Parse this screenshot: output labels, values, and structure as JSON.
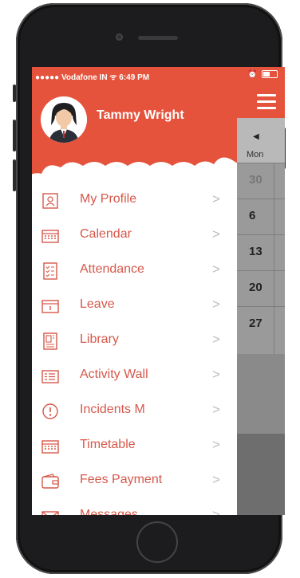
{
  "status_bar": {
    "carrier": "●●●●● Vodafone IN",
    "time": "6:49 PM"
  },
  "drawer": {
    "user_name": "Tammy Wright",
    "items": [
      {
        "label": "My Profile",
        "icon": "profile-icon"
      },
      {
        "label": "Calendar",
        "icon": "calendar-icon"
      },
      {
        "label": "Attendance",
        "icon": "attendance-icon"
      },
      {
        "label": "Leave",
        "icon": "leave-icon"
      },
      {
        "label": "Library",
        "icon": "library-icon"
      },
      {
        "label": "Activity Wall",
        "icon": "activity-wall-icon"
      },
      {
        "label": "Incidents M",
        "icon": "incidents-icon"
      },
      {
        "label": "Timetable",
        "icon": "timetable-icon"
      },
      {
        "label": "Fees Payment",
        "icon": "wallet-icon"
      },
      {
        "label": "Messages",
        "icon": "envelope-icon"
      }
    ]
  },
  "calendar_peek": {
    "day": "Mon",
    "dates": [
      "30",
      "6",
      "13",
      "20",
      "27"
    ]
  },
  "colors": {
    "accent": "#e5533d",
    "menu_text": "#d6584a"
  }
}
